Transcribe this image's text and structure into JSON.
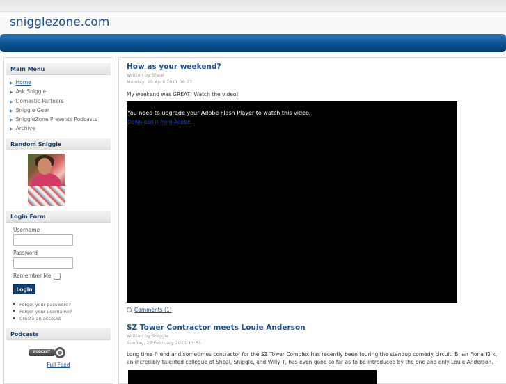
{
  "site": {
    "title": "snigglezone.com"
  },
  "sidebar": {
    "main_menu": {
      "title": "Main Menu",
      "items": [
        {
          "label": "Home",
          "active": true
        },
        {
          "label": "Ask Sniggle",
          "active": false
        },
        {
          "label": "Domestic Partners",
          "active": false
        },
        {
          "label": "Sniggle Gear",
          "active": false
        },
        {
          "label": "SniggleZone Presents Podcasts",
          "active": false
        },
        {
          "label": "Archive",
          "active": false
        }
      ]
    },
    "random_sniggle": {
      "title": "Random Sniggle"
    },
    "login_form": {
      "title": "Login Form",
      "username_label": "Username",
      "username_value": "",
      "password_label": "Password",
      "password_value": "",
      "remember_label": "Remember Me",
      "remember_checked": false,
      "login_button": "Login",
      "links": [
        "Forgot your password?",
        "Forgot your username?",
        "Create an account"
      ]
    },
    "podcasts": {
      "title": "Podcasts",
      "badge_text": "PODCAST",
      "full_feed": "Full Feed"
    }
  },
  "articles": [
    {
      "title": "How as your weekend?",
      "written_by": "Written by Sheal",
      "date": "Monday, 25 April 2011 08:27",
      "intro": "My weekend was GREAT! Watch the video!",
      "video_message": "You need to upgrade your Adobe Flash Player to watch this video.",
      "video_link": "Download it from Adobe.",
      "comments": "Comments (1)"
    },
    {
      "title": "SZ Tower Contractor meets Louie Anderson",
      "written_by": "Written by Sniggle",
      "date": "Sunday, 27 February 2011 13:35",
      "intro": "Long time friend and sometimes contractor for the SZ Tower Complex has recently been touring the standup comedy circuit. Brian Fiona Kirk, an incredibly talented collegue of Sheal, Sniggle, and Willy T, has even gone so far as to be introduced by the one and only Louie Anderson."
    }
  ],
  "colors": {
    "brand_blue": "#1b4f8e",
    "nav_blue": "#0b4d8c",
    "button_navy": "#113f73"
  }
}
